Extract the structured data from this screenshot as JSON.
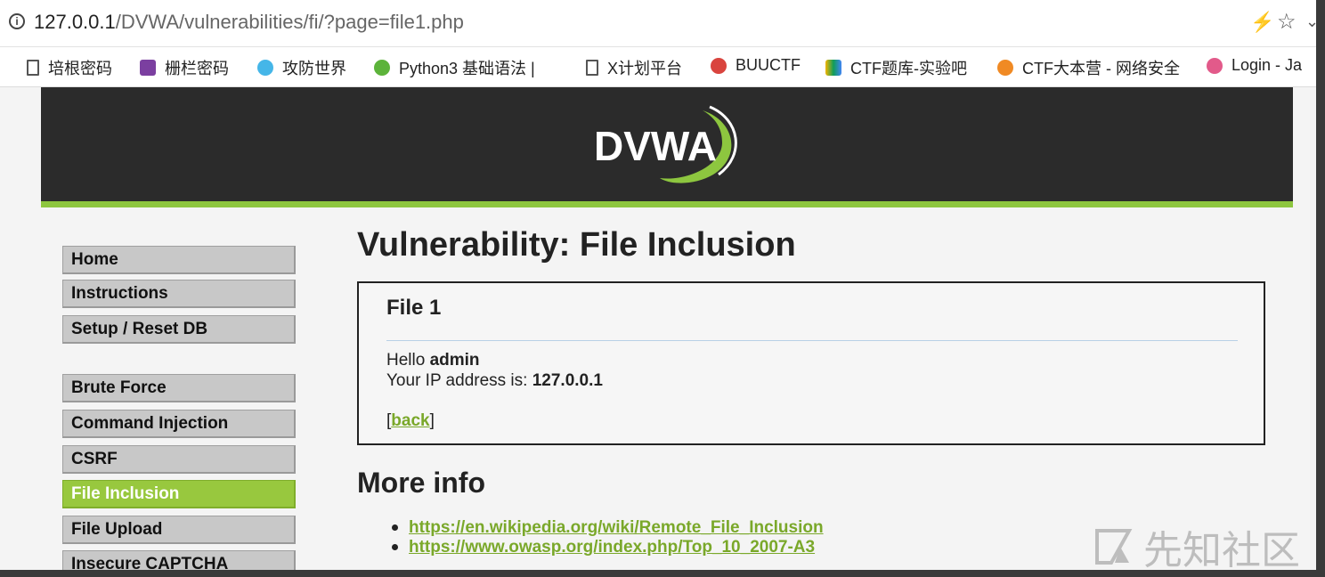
{
  "browser": {
    "url_host": "127.0.0.1",
    "url_path": "/DVWA/vulnerabilities/fi/?page=file1.php"
  },
  "bookmarks": [
    {
      "label": "培根密码",
      "icon": "page-icon"
    },
    {
      "label": "栅栏密码",
      "icon": "purple-app-icon"
    },
    {
      "label": "攻防世界",
      "icon": "blue-globe-icon"
    },
    {
      "label": "Python3 基础语法 | ",
      "icon": "green-site-icon"
    },
    {
      "label": "X计划平台",
      "icon": "page-icon"
    },
    {
      "label": "BUUCTF",
      "icon": "red-shield-icon"
    },
    {
      "label": "CTF题库-实验吧",
      "icon": "multicolor-icon"
    },
    {
      "label": "CTF大本营 - 网络安全",
      "icon": "orange-icon"
    },
    {
      "label": "Login - Ja",
      "icon": "pink-icon"
    }
  ],
  "logo": {
    "text": "DVWA"
  },
  "menu": {
    "group1": [
      "Home",
      "Instructions",
      "Setup / Reset DB"
    ],
    "group2": [
      "Brute Force",
      "Command Injection",
      "CSRF",
      "File Inclusion",
      "File Upload",
      "Insecure CAPTCHA"
    ],
    "selected": "File Inclusion"
  },
  "main": {
    "title": "Vulnerability: File Inclusion",
    "box_title": "File 1",
    "hello_prefix": "Hello ",
    "hello_user": "admin",
    "ip_prefix": "Your IP address is: ",
    "ip_value": "127.0.0.1",
    "back_open": "[",
    "back_label": "back",
    "back_close": "]",
    "more_info": "More info",
    "links": [
      "https://en.wikipedia.org/wiki/Remote_File_Inclusion",
      "https://www.owasp.org/index.php/Top_10_2007-A3"
    ]
  },
  "watermark": {
    "text": "先知社区"
  },
  "colors": {
    "accent": "#98c83e",
    "header": "#2b2b2b",
    "link": "#7aa82a"
  }
}
